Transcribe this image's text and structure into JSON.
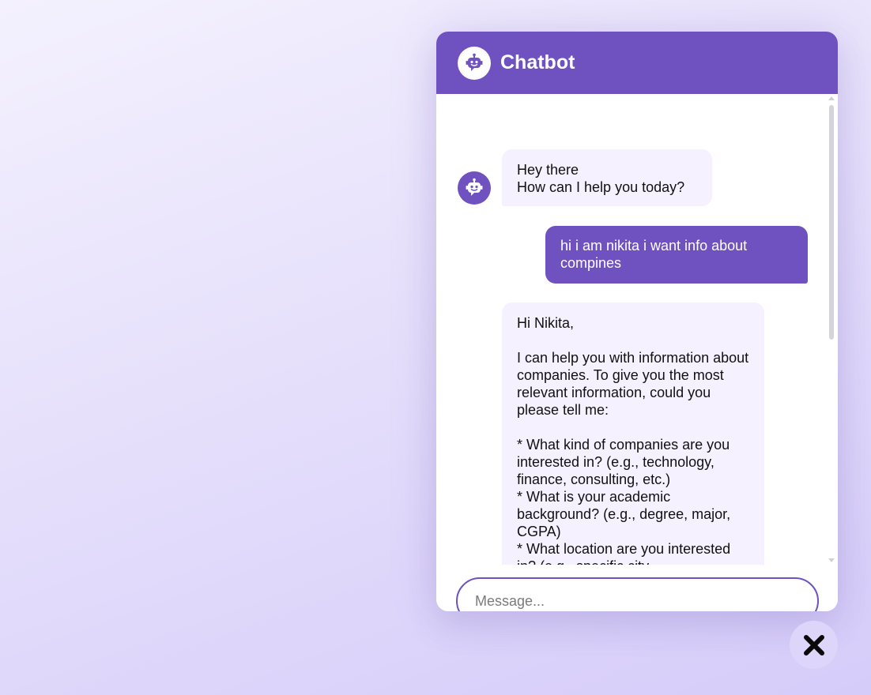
{
  "header": {
    "title": "Chatbot",
    "avatar_icon": "robot-icon",
    "background": "#6f51c0"
  },
  "messages": [
    {
      "role": "bot",
      "text": "Hey there\nHow can I help you today?"
    },
    {
      "role": "user",
      "text": "hi i am nikita i want info about compines"
    },
    {
      "role": "bot",
      "text": "Hi Nikita,\n\nI can help you with information about companies. To give you the most relevant information, could you please tell me:\n\n* What kind of companies are you interested in? (e.g., technology, finance, consulting, etc.)\n* What is your academic background? (e.g., degree, major, CGPA)\n* What location are you interested in? (e.g., specific city"
    }
  ],
  "input": {
    "placeholder": "Message...",
    "value": ""
  },
  "toggle": {
    "icon": "close-icon"
  },
  "colors": {
    "accent": "#6f51c0",
    "bot_bubble": "#f5f1fe",
    "toggle_bg": "#ddd5fa"
  }
}
